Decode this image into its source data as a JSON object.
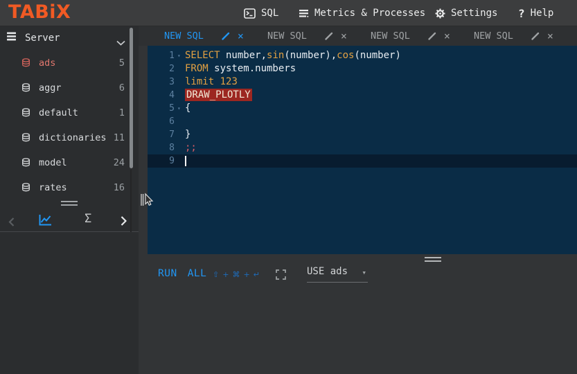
{
  "topbar": {
    "logo": "TABiX",
    "items": [
      {
        "label": "SQL"
      },
      {
        "label": "Metrics & Processes"
      },
      {
        "label": "Settings"
      },
      {
        "label": "Help"
      }
    ]
  },
  "sidebar": {
    "server_label": "Server",
    "databases": [
      {
        "name": "ads",
        "count": "5",
        "active": true
      },
      {
        "name": "aggr",
        "count": "6",
        "active": false
      },
      {
        "name": "default",
        "count": "1",
        "active": false
      },
      {
        "name": "dictionaries",
        "count": "11",
        "active": false
      },
      {
        "name": "model",
        "count": "24",
        "active": false
      },
      {
        "name": "rates",
        "count": "16",
        "active": false
      }
    ],
    "footer": {
      "sigma_label": "Σ"
    }
  },
  "tabs": {
    "close_glyph": "×",
    "items": [
      {
        "label": "NEW SQL",
        "active": true
      },
      {
        "label": "NEW SQL",
        "active": false
      },
      {
        "label": "NEW SQL",
        "active": false
      },
      {
        "label": "NEW SQL",
        "active": false
      }
    ]
  },
  "editor": {
    "fold_glyph": "▾",
    "active_line": 9,
    "lines": [
      {
        "n": 1,
        "fold": true,
        "tokens": [
          [
            "kw",
            "SELECT"
          ],
          [
            "pl",
            " number,"
          ],
          [
            "fn",
            "sin"
          ],
          [
            "pl",
            "(number),"
          ],
          [
            "fn",
            "cos"
          ],
          [
            "pl",
            "(number)"
          ]
        ]
      },
      {
        "n": 2,
        "fold": false,
        "tokens": [
          [
            "kw",
            "FROM"
          ],
          [
            "pl",
            " system.numbers"
          ]
        ]
      },
      {
        "n": 3,
        "fold": false,
        "tokens": [
          [
            "kw",
            "limit"
          ],
          [
            "pl",
            " "
          ],
          [
            "num",
            "123"
          ]
        ]
      },
      {
        "n": 4,
        "fold": false,
        "tokens": [
          [
            "err",
            "DRAW_PLOTLY"
          ]
        ]
      },
      {
        "n": 5,
        "fold": true,
        "tokens": [
          [
            "pl",
            "{"
          ]
        ]
      },
      {
        "n": 6,
        "fold": false,
        "tokens": []
      },
      {
        "n": 7,
        "fold": false,
        "tokens": [
          [
            "pl",
            "}"
          ]
        ]
      },
      {
        "n": 8,
        "fold": false,
        "tokens": [
          [
            "semi",
            ";;"
          ]
        ]
      },
      {
        "n": 9,
        "fold": false,
        "tokens": []
      }
    ]
  },
  "toolbar": {
    "run_label": "RUN",
    "all_label": "ALL",
    "shortcut_keys": [
      "⇧",
      "+",
      "⌘",
      "+",
      "↵"
    ],
    "use_label": "USE ads",
    "caret_glyph": "▾"
  },
  "colors": {
    "accent_blue": "#2196f3",
    "logo_orange": "#f15a24",
    "keyword_orange": "#e3a142",
    "error_bg": "#9c2721",
    "db_active_red": "#e0736b",
    "editor_bg": "#0a2c46",
    "active_line_bg": "#081c2f",
    "semicolon_red": "#d95d66"
  }
}
